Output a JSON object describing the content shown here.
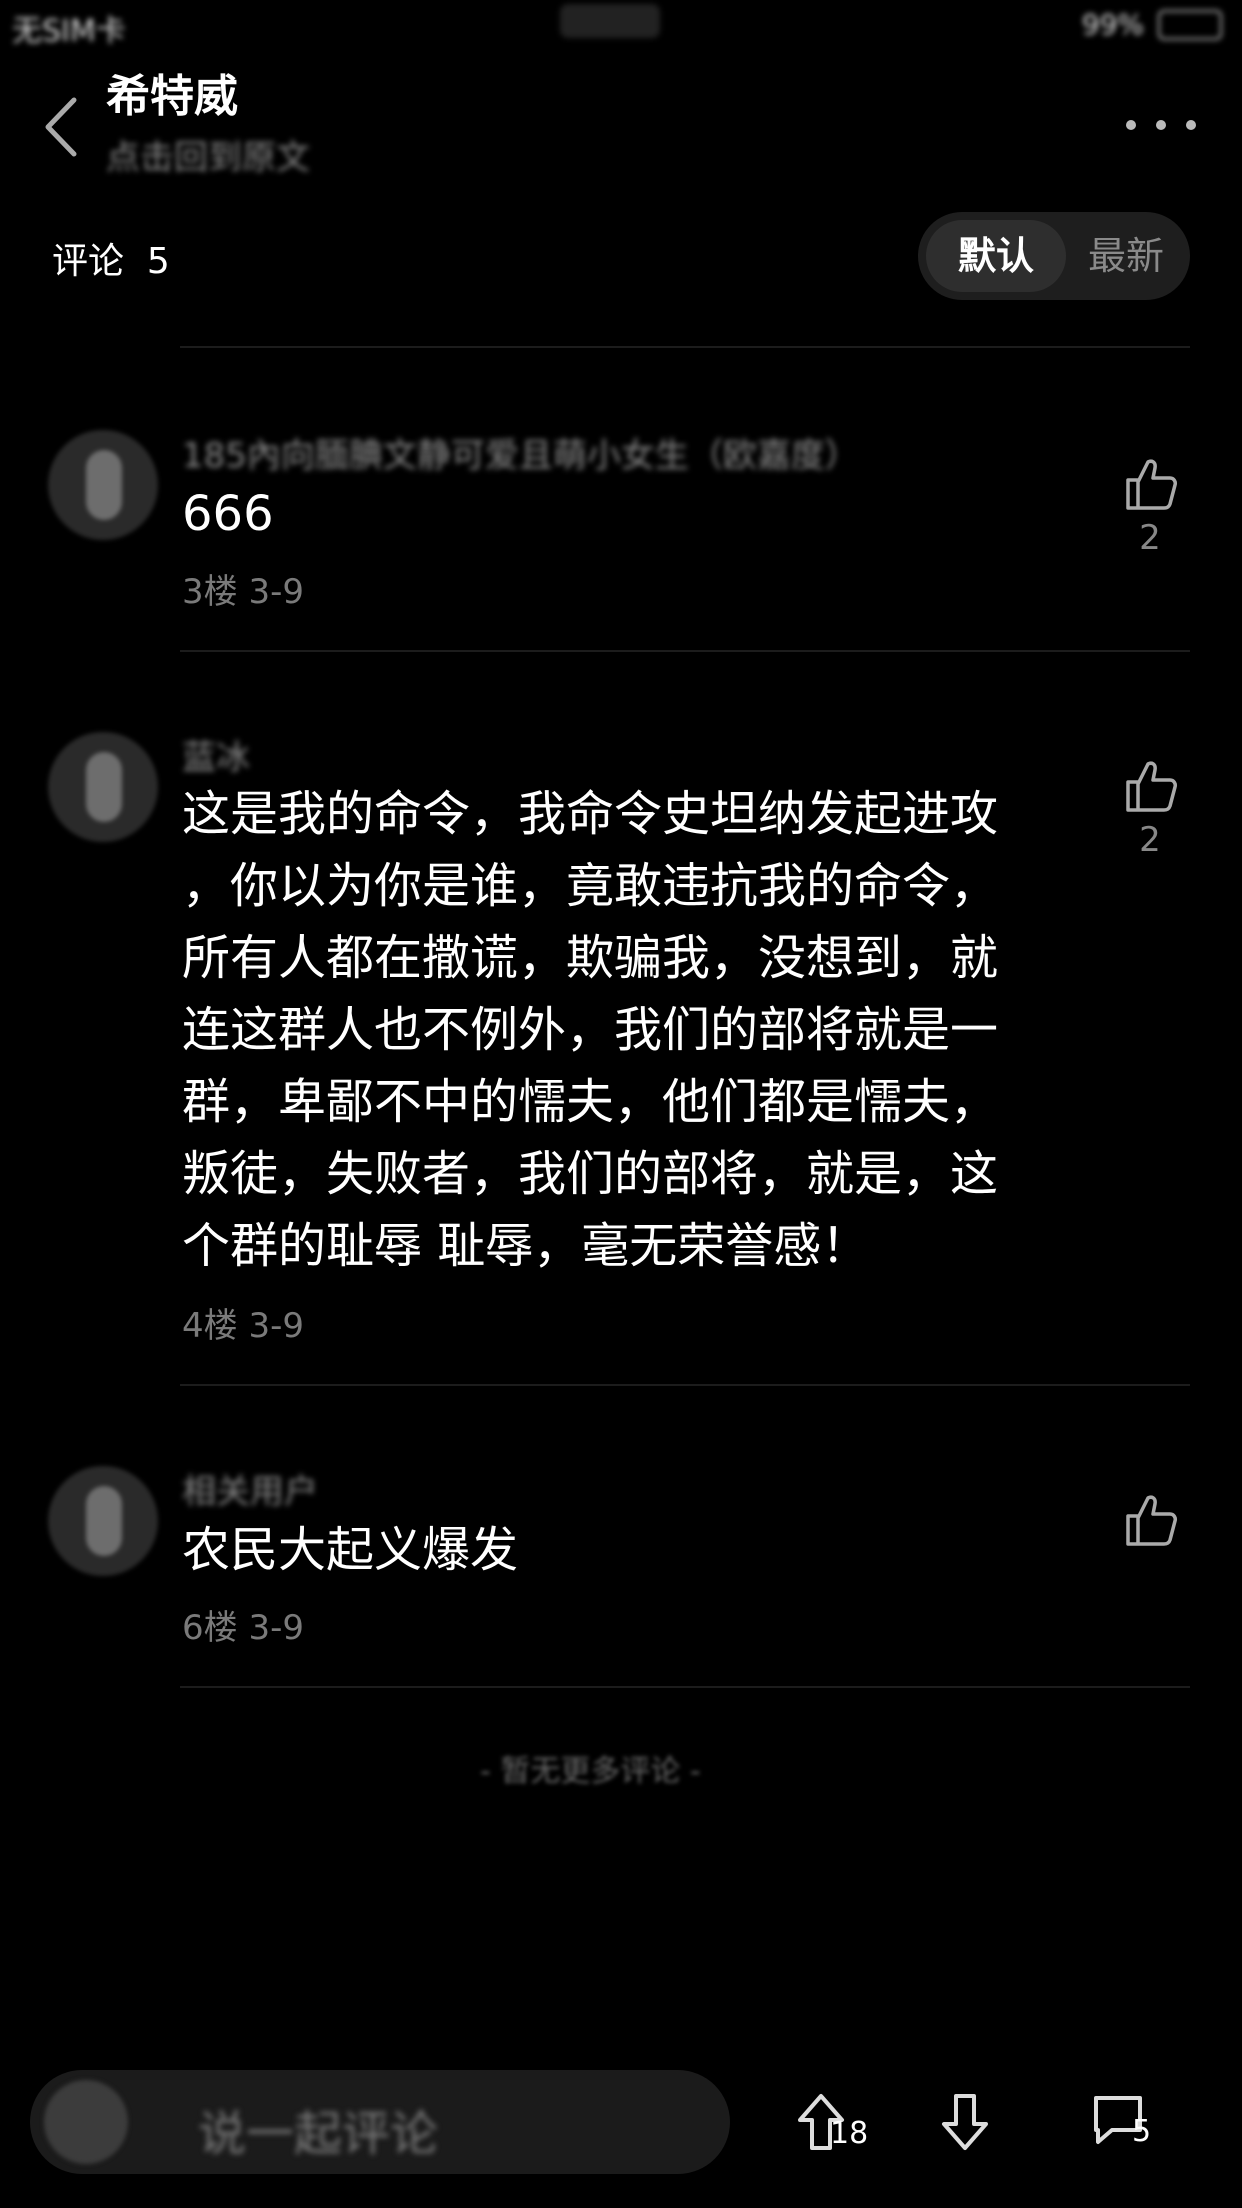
{
  "status_bar": {
    "carrier": "无SIM卡",
    "battery": "99%"
  },
  "header": {
    "title": "希特威",
    "subtitle": "点击回到原文"
  },
  "comments_header": {
    "label": "评论",
    "count": "5"
  },
  "sort": {
    "default_label": "默认",
    "latest_label": "最新"
  },
  "comments": [
    {
      "username": "185內向腼腆文静可爱且萌小女生（欧嘉度）",
      "text": "666",
      "meta": "3楼 3-9",
      "likes": "2"
    },
    {
      "username": "蓝冰",
      "text": "这是我的命令，我命令史坦纳发起进攻\n，你以为你是谁，竟敢违抗我的命令，\n所有人都在撒谎，欺骗我，没想到，就\n连这群人也不例外，我们的部将就是一\n群，卑鄙不中的懦夫，他们都是懦夫，\n叛徒，失败者，我们的部将，就是，这\n个群的耻辱 耻辱，毫无荣誉感！",
      "meta": "4楼 3-9",
      "likes": "2"
    },
    {
      "username": "相关用户",
      "text": "农民大起义爆发",
      "meta": "6楼 3-9",
      "likes": ""
    }
  ],
  "footer_note": "- 暂无更多评论 -",
  "bottom_bar": {
    "input_placeholder": "说一起评论",
    "upvote_count": "18",
    "comment_count": "5"
  }
}
